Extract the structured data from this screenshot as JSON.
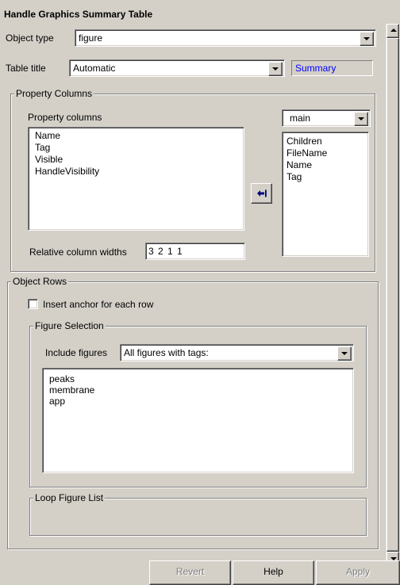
{
  "window": {
    "title": "Handle Graphics Summary Table"
  },
  "object_type": {
    "label": "Object type",
    "value": "figure"
  },
  "table_title": {
    "label": "Table title",
    "value": "Automatic",
    "summary_text": "Summary"
  },
  "property_columns": {
    "group_label": "Property Columns",
    "list_label": "Property columns",
    "selected_items": [
      "Name",
      "Tag",
      "Visible",
      "HandleVisibility"
    ],
    "source_dropdown": "main",
    "available_items": [
      "Children",
      "FileName",
      "Name",
      "Tag"
    ],
    "widths_label": "Relative column widths",
    "widths_value": "3 2 1 1"
  },
  "object_rows": {
    "group_label": "Object Rows",
    "anchor_checkbox_label": "Insert anchor for each row",
    "anchor_checked": false,
    "figure_selection": {
      "group_label": "Figure Selection",
      "include_label": "Include figures",
      "include_value": "All figures with tags:",
      "tags": [
        "peaks",
        "membrane",
        "app"
      ]
    },
    "loop_figure_list": {
      "group_label": "Loop Figure List"
    }
  },
  "buttons": {
    "revert": "Revert",
    "help": "Help",
    "apply": "Apply"
  }
}
